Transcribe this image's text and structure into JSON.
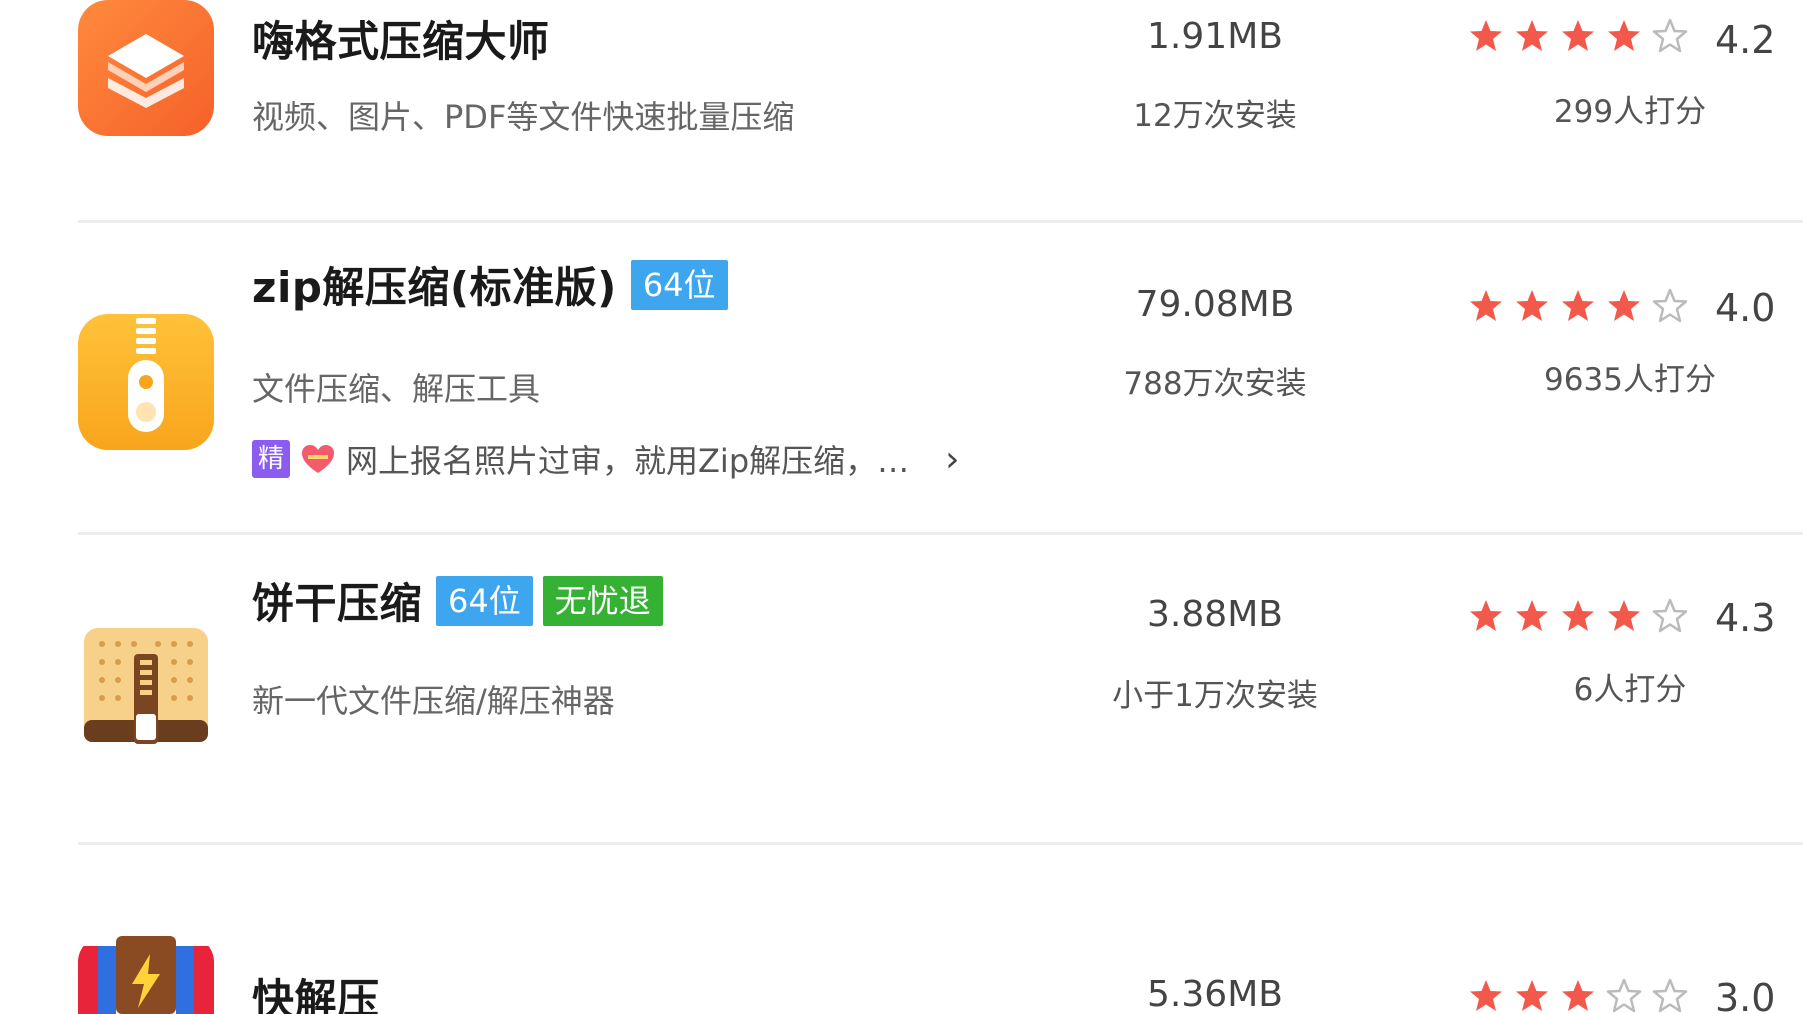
{
  "apps": [
    {
      "name": "嗨格式压缩大师",
      "badges": [],
      "description": "视频、图片、PDF等文件快速批量压缩",
      "size": "1.91MB",
      "installs": "12万次安装",
      "rating": 4.2,
      "rating_text": "4.2",
      "stars_filled": 4,
      "raters": "299人打分",
      "icon": "layers-icon"
    },
    {
      "name": "zip解压缩(标准版)",
      "badges": [
        {
          "text": "64位",
          "color": "#3ea6ee"
        }
      ],
      "description": "文件压缩、解压工具",
      "promo": {
        "tag": "精",
        "text": "网上报名照片过审，就用Zip解压缩，…",
        "arrow": "›"
      },
      "size": "79.08MB",
      "installs": "788万次安装",
      "rating": 4.0,
      "rating_text": "4.0",
      "stars_filled": 4,
      "raters": "9635人打分",
      "icon": "zipper-icon"
    },
    {
      "name": "饼干压缩",
      "badges": [
        {
          "text": "64位",
          "color": "#3ea6ee"
        },
        {
          "text": "无忧退",
          "color": "#35b234"
        }
      ],
      "description": "新一代文件压缩/解压神器",
      "size": "3.88MB",
      "installs": "小于1万次安装",
      "rating": 4.3,
      "rating_text": "4.3",
      "stars_filled": 4,
      "raters": "6人打分",
      "icon": "biscuit-icon"
    },
    {
      "name": "快解压",
      "badges": [],
      "size": "5.36MB",
      "rating": 3.0,
      "rating_text": "3.0",
      "stars_filled": 3,
      "icon": "lightning-archive-icon"
    }
  ],
  "colors": {
    "star_filled": "#f2594b",
    "star_empty": "#bbbbbb",
    "badge_blue": "#3ea6ee",
    "badge_green": "#35b234"
  }
}
